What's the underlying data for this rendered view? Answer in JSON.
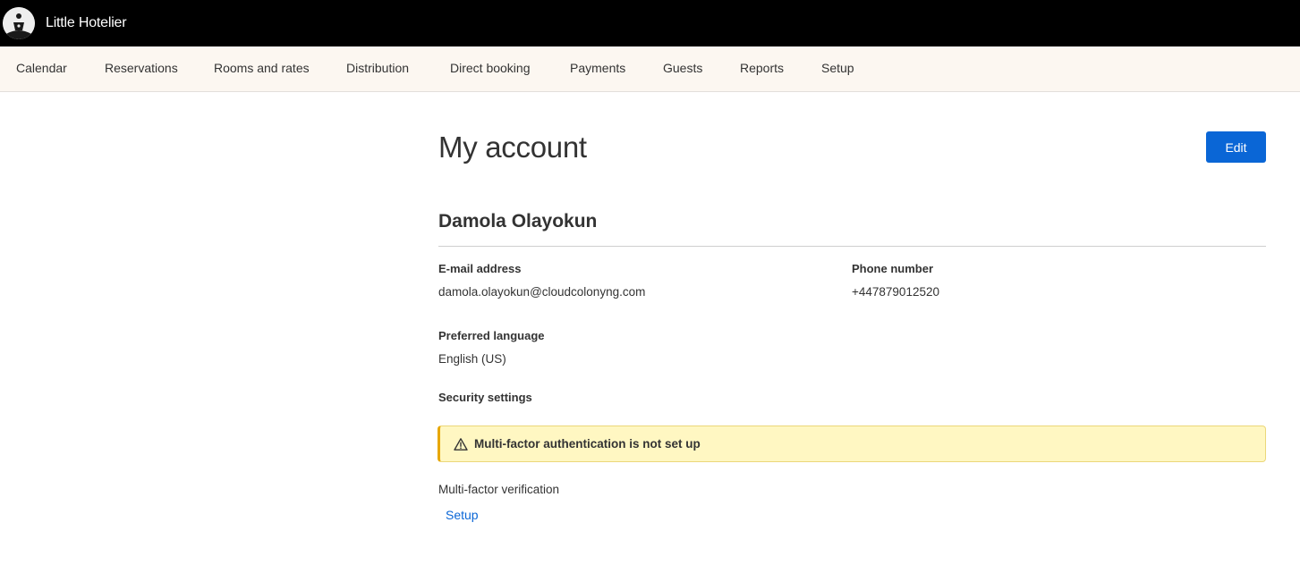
{
  "app": {
    "title": "Little Hotelier"
  },
  "nav": {
    "items": [
      {
        "label": "Calendar"
      },
      {
        "label": "Reservations"
      },
      {
        "label": "Rooms and rates"
      },
      {
        "label": "Distribution"
      },
      {
        "label": "Direct booking"
      },
      {
        "label": "Payments"
      },
      {
        "label": "Guests"
      },
      {
        "label": "Reports"
      },
      {
        "label": "Setup"
      }
    ]
  },
  "account": {
    "page_title": "My account",
    "edit_label": "Edit",
    "user_name": "Damola Olayokun",
    "email_label": "E-mail address",
    "email_value": "damola.olayokun@cloudcolonyng.com",
    "phone_label": "Phone number",
    "phone_value": "+447879012520",
    "language_label": "Preferred language",
    "language_value": "English (US)",
    "security_label": "Security settings",
    "mfa_alert": "Multi-factor authentication is not set up",
    "mfa_label": "Multi-factor verification",
    "mfa_setup_link": "Setup"
  },
  "icons": {
    "logo": "hotelier-logo-icon",
    "alert": "warning-triangle-icon"
  },
  "colors": {
    "topbar": "#000000",
    "navbar": "#fcf7f1",
    "accent": "#0a66d6",
    "alert_bg": "#fff7c2",
    "alert_border": "#e7a700"
  }
}
